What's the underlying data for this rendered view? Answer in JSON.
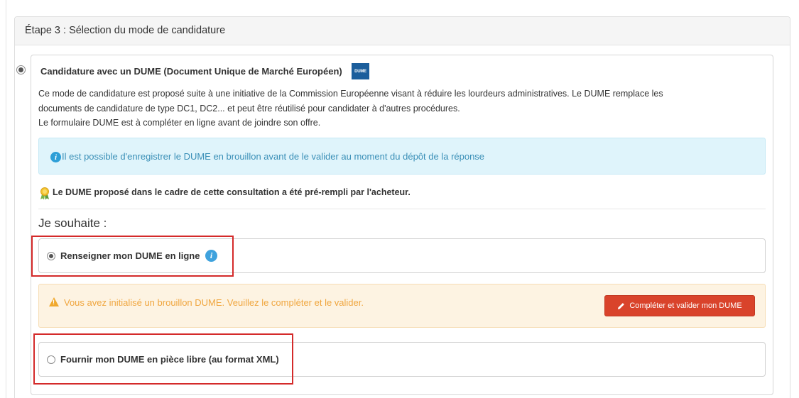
{
  "step": {
    "title": "Étape 3 : Sélection du mode de candidature"
  },
  "dume_option": {
    "title": "Candidature avec un DUME (Document Unique de Marché Européen)",
    "logo_text": "DUME",
    "description_lines": [
      "Ce mode de candidature est proposé suite à une initiative de la Commission Européenne visant à réduire les lourdeurs administratives. Le DUME remplace les",
      "documents de candidature de type DC1, DC2... et peut être réutilisé pour candidater à d'autres procédures.",
      "Le formulaire DUME est à compléter en ligne avant de joindre son offre."
    ],
    "info_message": "Il est possible d'enregistrer le DUME en brouillon avant de le valider au moment du dépôt de la réponse",
    "prefilled_message": "Le DUME proposé dans le cadre de cette consultation a été pré-rempli par l'acheteur."
  },
  "wish": {
    "label": "Je souhaite :",
    "options": [
      {
        "label": "Renseigner mon DUME en ligne",
        "selected": true
      },
      {
        "label": "Fournir mon DUME en pièce libre (au format XML)",
        "selected": false
      }
    ]
  },
  "warning": {
    "message": "Vous avez initialisé un brouillon DUME. Veuillez le compléter et le valider.",
    "button_label": "Compléter et valider mon DUME"
  },
  "colors": {
    "info_blue": "#2e9fd7",
    "warning_orange": "#f0a63f",
    "action_red": "#d9432b",
    "highlight_red": "#d42a2a"
  }
}
